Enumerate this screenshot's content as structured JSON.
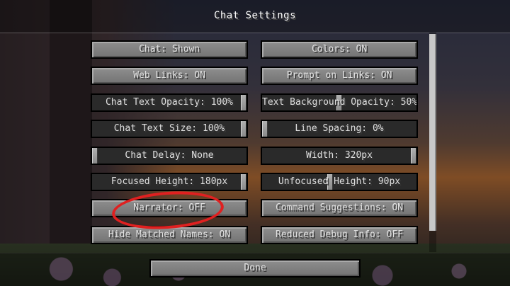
{
  "screen": {
    "title": "Chat Settings"
  },
  "left_column": [
    {
      "label": "Chat: Shown",
      "kind": "button"
    },
    {
      "label": "Web Links: ON",
      "kind": "button"
    },
    {
      "label": "Chat Text Opacity: 100%",
      "kind": "slider",
      "value": 1.0
    },
    {
      "label": "Chat Text Size: 100%",
      "kind": "slider",
      "value": 1.0
    },
    {
      "label": "Chat Delay: None",
      "kind": "slider",
      "value": 0.0
    },
    {
      "label": "Focused Height: 180px",
      "kind": "slider",
      "value": 1.0
    },
    {
      "label": "Narrator: OFF",
      "kind": "button"
    },
    {
      "label": "Hide Matched Names: ON",
      "kind": "button"
    }
  ],
  "right_column": [
    {
      "label": "Colors: ON",
      "kind": "button"
    },
    {
      "label": "Prompt on Links: ON",
      "kind": "button"
    },
    {
      "label": "Text Background Opacity: 50%",
      "kind": "slider",
      "value": 0.5
    },
    {
      "label": "Line Spacing: 0%",
      "kind": "slider",
      "value": 0.0
    },
    {
      "label": "Width: 320px",
      "kind": "slider",
      "value": 1.0
    },
    {
      "label": "Unfocused Height: 90px",
      "kind": "slider",
      "value": 0.44
    },
    {
      "label": "Command Suggestions: ON",
      "kind": "button"
    },
    {
      "label": "Reduced Debug Info: OFF",
      "kind": "button"
    }
  ],
  "footer": {
    "done_label": "Done"
  },
  "annotation": {
    "color": "#e02020",
    "target": "Narrator: OFF"
  }
}
